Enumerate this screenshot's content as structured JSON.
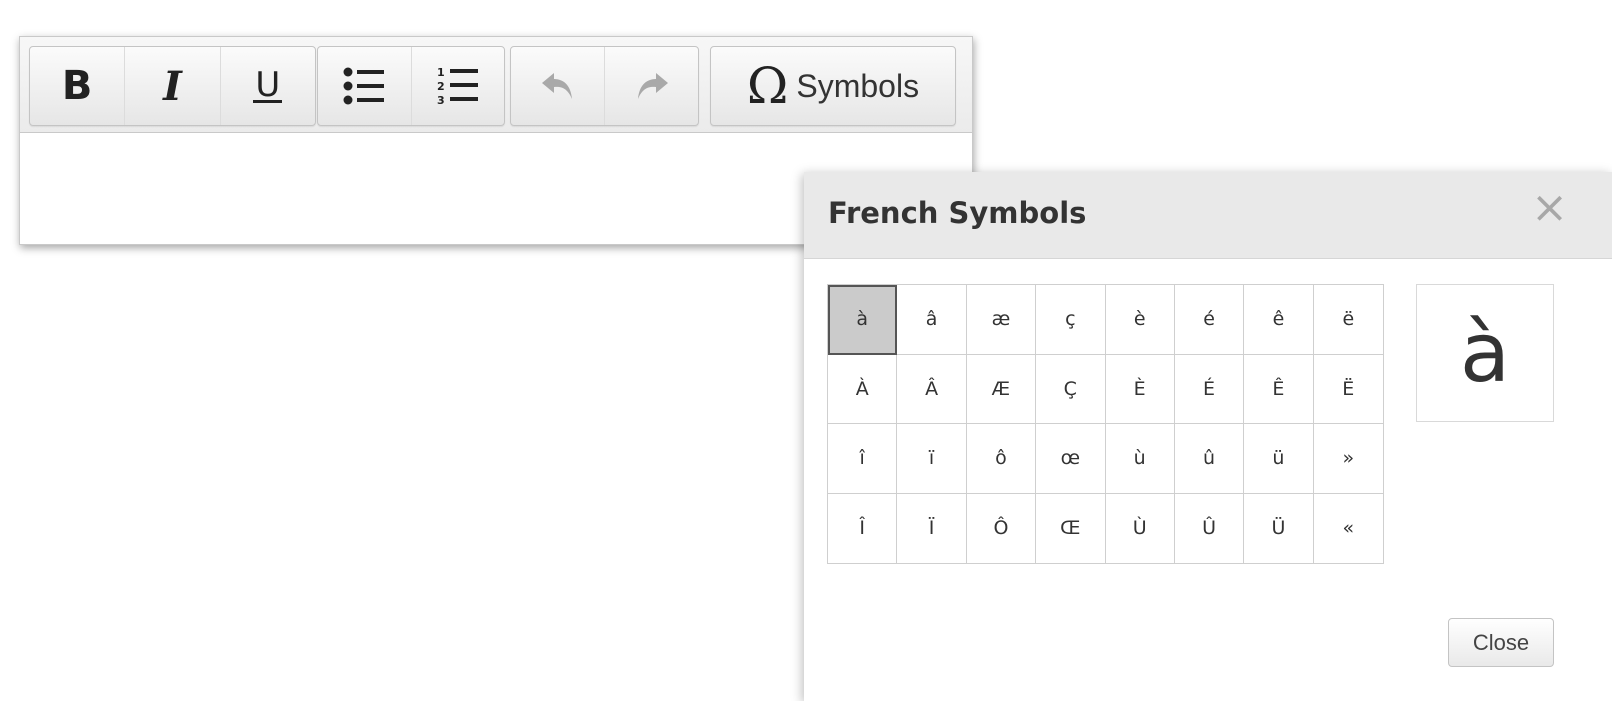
{
  "toolbar": {
    "bold_label": "B",
    "italic_label": "I",
    "underline_label": "U",
    "symbols_glyph": "Ω",
    "symbols_label": "Symbols"
  },
  "icons": {
    "bold": "bold-icon",
    "italic": "italic-icon",
    "underline": "underline-icon",
    "bulleted_list": "bulleted-list-icon",
    "numbered_list": "numbered-list-icon",
    "undo": "undo-icon",
    "redo": "redo-icon",
    "omega": "omega-icon",
    "close": "close-icon"
  },
  "dialog": {
    "title": "French Symbols",
    "close_x": "×",
    "selected_char": "à",
    "preview_char": "à",
    "close_button_label": "Close",
    "rows": [
      [
        "à",
        "â",
        "æ",
        "ç",
        "è",
        "é",
        "ê",
        "ë"
      ],
      [
        "À",
        "Â",
        "Æ",
        "Ç",
        "È",
        "É",
        "Ê",
        "Ë"
      ],
      [
        "î",
        "ï",
        "ô",
        "œ",
        "ù",
        "û",
        "ü",
        "»"
      ],
      [
        "Î",
        "Ï",
        "Ô",
        "Œ",
        "Ù",
        "Û",
        "Ü",
        "«"
      ]
    ]
  },
  "colors": {
    "header_bg": "#e9e9e9",
    "selected_cell_bg": "#cbcbcb",
    "disabled_icon": "#a9a9a9",
    "text": "#333333"
  }
}
